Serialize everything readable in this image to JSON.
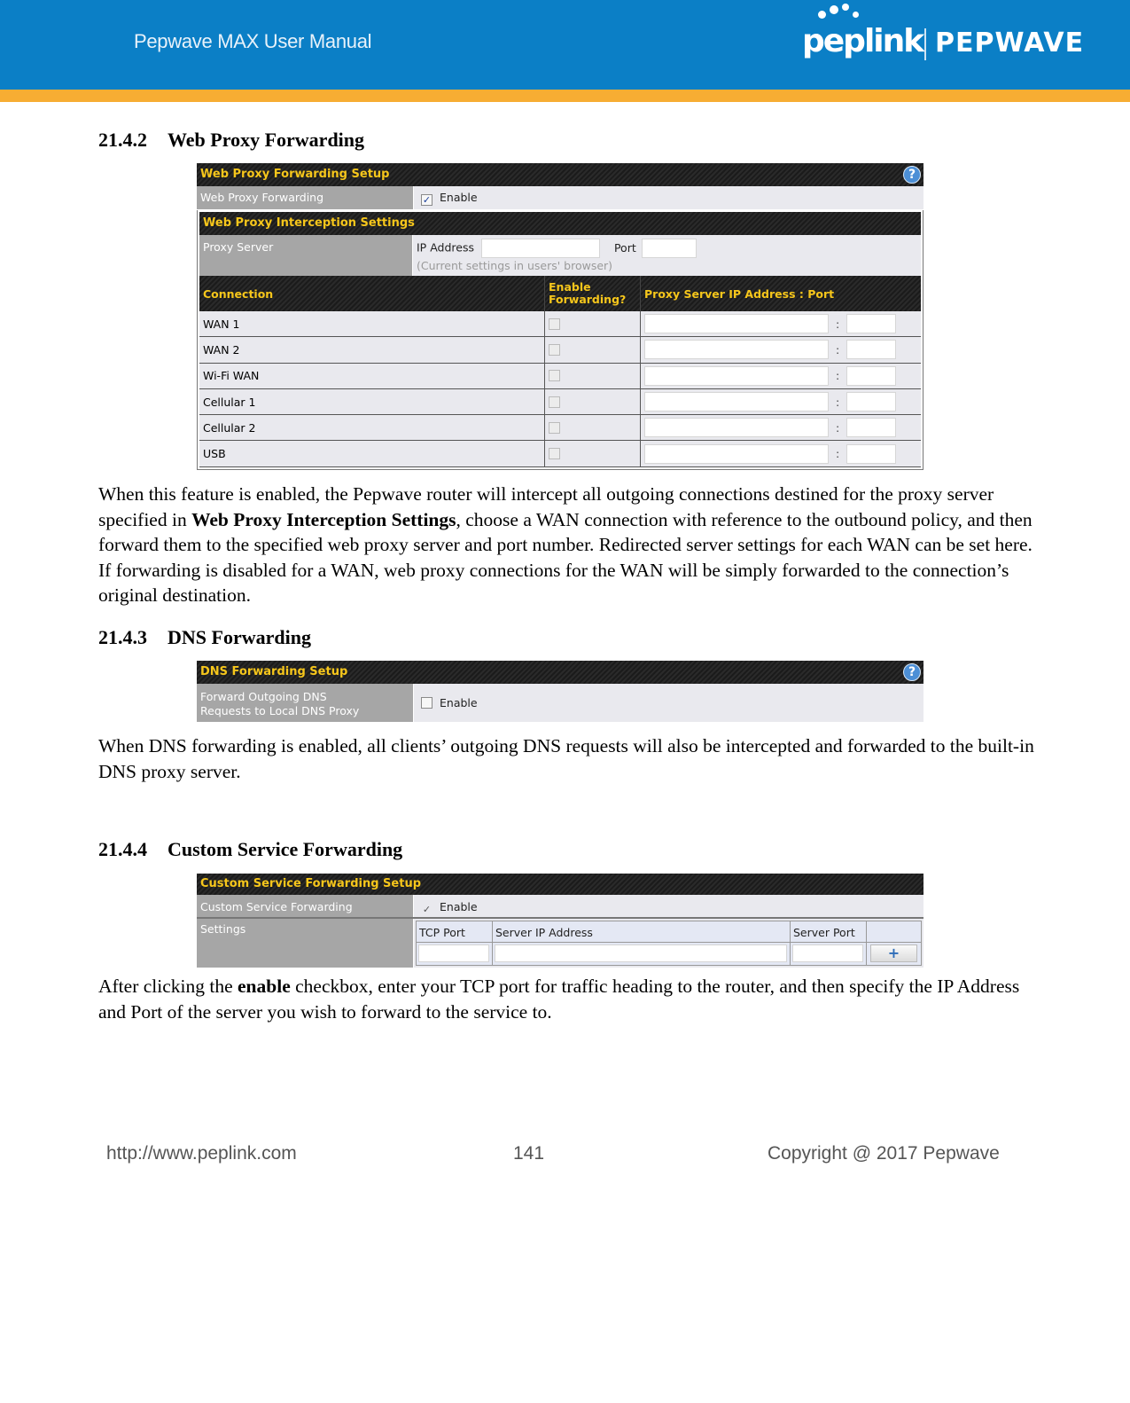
{
  "header": {
    "manual_title": "Pepwave MAX User Manual",
    "logo_left": "peplink",
    "logo_right": "PEPWAVE",
    "colors": {
      "blue": "#0b7fc6",
      "orange": "#f7ad33"
    }
  },
  "sections": {
    "web_proxy": {
      "number": "21.4.2",
      "title": "Web Proxy Forwarding",
      "panel": {
        "title": "Web Proxy Forwarding Setup",
        "help": "?",
        "forwarding_label": "Web Proxy Forwarding",
        "enable_label": "Enable",
        "enable_checked": true,
        "interception_title": "Web Proxy Interception Settings",
        "proxy_server_label": "Proxy Server",
        "ip_address_label": "IP Address",
        "ip_address_value": "",
        "port_label": "Port",
        "port_value": "",
        "note": "(Current settings in users' browser)",
        "columns": [
          "Connection",
          "Enable Forwarding?",
          "Proxy Server IP Address : Port"
        ],
        "rows": [
          {
            "connection": "WAN 1",
            "enabled": false,
            "ip": "",
            "port": ""
          },
          {
            "connection": "WAN 2",
            "enabled": false,
            "ip": "",
            "port": ""
          },
          {
            "connection": "Wi-Fi WAN",
            "enabled": false,
            "ip": "",
            "port": ""
          },
          {
            "connection": "Cellular 1",
            "enabled": false,
            "ip": "",
            "port": ""
          },
          {
            "connection": "Cellular 2",
            "enabled": false,
            "ip": "",
            "port": ""
          },
          {
            "connection": "USB",
            "enabled": false,
            "ip": "",
            "port": ""
          }
        ],
        "colon": ":"
      },
      "para_1": "When this feature is enabled, the Pepwave router will intercept all outgoing connections destined for the proxy server specified in ",
      "para_bold": "Web Proxy Interception Settings",
      "para_2": ", choose a WAN connection with reference to the outbound policy, and then forward them to the specified web proxy server and port number. Redirected server settings for each WAN can be set here. If forwarding is disabled for a WAN, web proxy connections for the WAN will be simply forwarded to the connection’s original destination."
    },
    "dns": {
      "number": "21.4.3",
      "title": "DNS Forwarding",
      "panel": {
        "title": "DNS Forwarding Setup",
        "help": "?",
        "label_line1": "Forward Outgoing DNS",
        "label_line2": "Requests to Local DNS Proxy",
        "enable_label": "Enable",
        "enable_checked": false
      },
      "para": "When DNS forwarding is enabled, all clients’ outgoing DNS requests will also be intercepted and forwarded to the built-in DNS proxy server."
    },
    "custom": {
      "number": "21.4.4",
      "title": "Custom Service Forwarding",
      "panel": {
        "title": "Custom Service Forwarding Setup",
        "forwarding_label": "Custom Service Forwarding",
        "enable_label": "Enable",
        "enable_checked": true,
        "settings_label": "Settings",
        "columns": [
          "TCP Port",
          "Server IP Address",
          "Server Port"
        ],
        "add_button": "+"
      },
      "para_1": "After clicking the ",
      "para_bold": "enable",
      "para_2": " checkbox, enter your TCP port for traffic heading to the router, and then specify the IP Address and Port of the server you wish to forward to the service to."
    }
  },
  "footer": {
    "url": "http://www.peplink.com",
    "page": "141",
    "copyright": "Copyright @ 2017 Pepwave"
  }
}
